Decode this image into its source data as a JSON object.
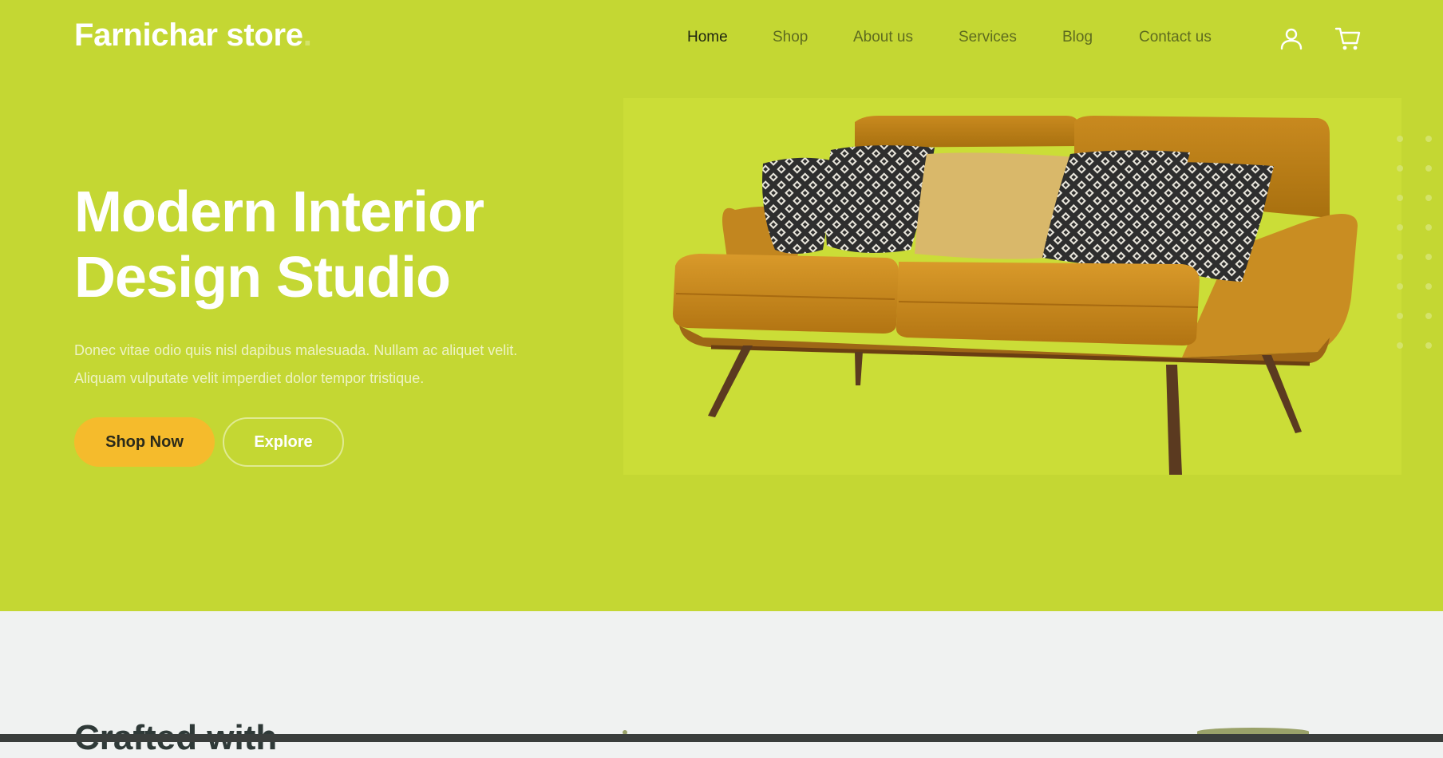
{
  "header": {
    "logo_text": "Farnichar store",
    "logo_dot": ".",
    "nav": [
      {
        "label": "Home",
        "active": true
      },
      {
        "label": "Shop",
        "active": false
      },
      {
        "label": "About us",
        "active": false
      },
      {
        "label": "Services",
        "active": false
      },
      {
        "label": "Blog",
        "active": false
      },
      {
        "label": "Contact us",
        "active": false
      }
    ],
    "icons": [
      "user-icon",
      "cart-icon"
    ]
  },
  "hero": {
    "title_line1": "Modern Interior",
    "title_line2": "Design Studio",
    "description": "Donec vitae odio quis nisl dapibus malesuada. Nullam ac aliquet velit. Aliquam vulputate velit imperdiet dolor tempor tristique.",
    "primary_button": "Shop Now",
    "secondary_button": "Explore",
    "image_icon": "sofa-image"
  },
  "next_section": {
    "title_partial": "Crafted with"
  },
  "colors": {
    "hero_bg": "#c4d733",
    "image_panel_bg": "#cbdd37",
    "primary_button": "#f5bb2c",
    "page_bg": "#f0f2f1"
  }
}
